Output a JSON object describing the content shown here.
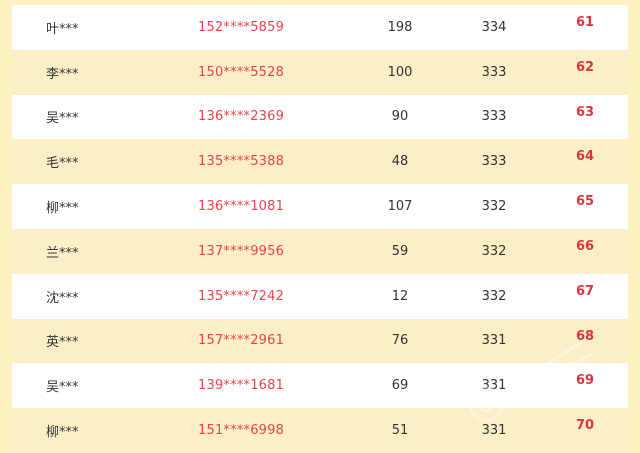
{
  "rows": [
    {
      "name": "叶***",
      "phone": "152****5859",
      "a": "198",
      "b": "334",
      "rank": "61"
    },
    {
      "name": "李***",
      "phone": "150****5528",
      "a": "100",
      "b": "333",
      "rank": "62"
    },
    {
      "name": "吴***",
      "phone": "136****2369",
      "a": "90",
      "b": "333",
      "rank": "63"
    },
    {
      "name": "毛***",
      "phone": "135****5388",
      "a": "48",
      "b": "333",
      "rank": "64"
    },
    {
      "name": "柳***",
      "phone": "136****1081",
      "a": "107",
      "b": "332",
      "rank": "65"
    },
    {
      "name": "兰***",
      "phone": "137****9956",
      "a": "59",
      "b": "332",
      "rank": "66"
    },
    {
      "name": "沈***",
      "phone": "135****7242",
      "a": "12",
      "b": "332",
      "rank": "67"
    },
    {
      "name": "英***",
      "phone": "157****2961",
      "a": "76",
      "b": "331",
      "rank": "68"
    },
    {
      "name": "吴***",
      "phone": "139****1681",
      "a": "69",
      "b": "331",
      "rank": "69"
    },
    {
      "name": "柳***",
      "phone": "151****6998",
      "a": "51",
      "b": "331",
      "rank": "70"
    }
  ],
  "colors": {
    "page_bg": "#fdf1c2",
    "row_white": "#ffffff",
    "row_cream": "#fcefc7",
    "phone_red": "#e8454a",
    "rank_red": "#d9363e"
  }
}
